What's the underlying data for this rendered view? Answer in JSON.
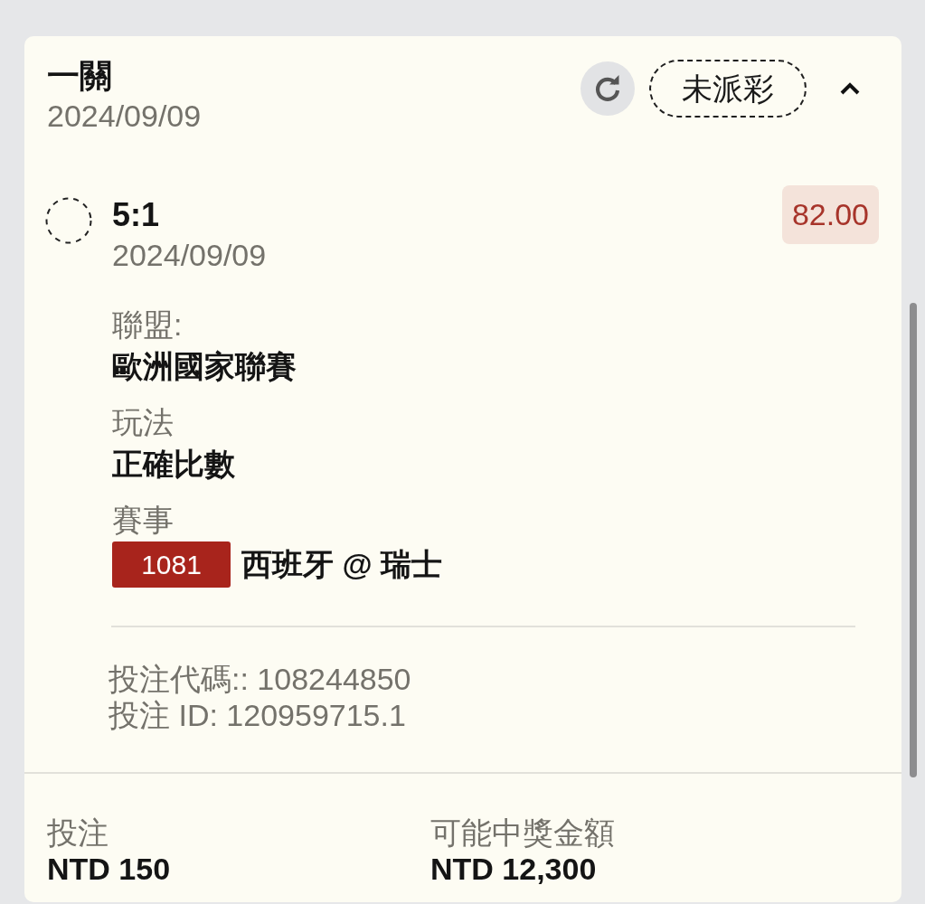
{
  "bet": {
    "title": "一關",
    "date": "2024/09/09",
    "status": "未派彩",
    "expanded": true
  },
  "selection": {
    "pick": "5:1",
    "date": "2024/09/09",
    "odds": "82.00",
    "details": [
      {
        "kind": "text",
        "label": "聯盟:",
        "value": "歐洲國家聯賽"
      },
      {
        "kind": "text",
        "label": "玩法",
        "value": "正確比數"
      },
      {
        "kind": "match",
        "label": "賽事",
        "match_number": "1081",
        "value": "西班牙 @ 瑞士"
      }
    ]
  },
  "bet_codes": [
    "投注代碼:: 108244850",
    "投注 ID: 120959715.1"
  ],
  "summary": [
    {
      "label": "投注",
      "value": "NTD 150"
    },
    {
      "label": "可能中獎金額",
      "value": "NTD 12,300"
    }
  ]
}
